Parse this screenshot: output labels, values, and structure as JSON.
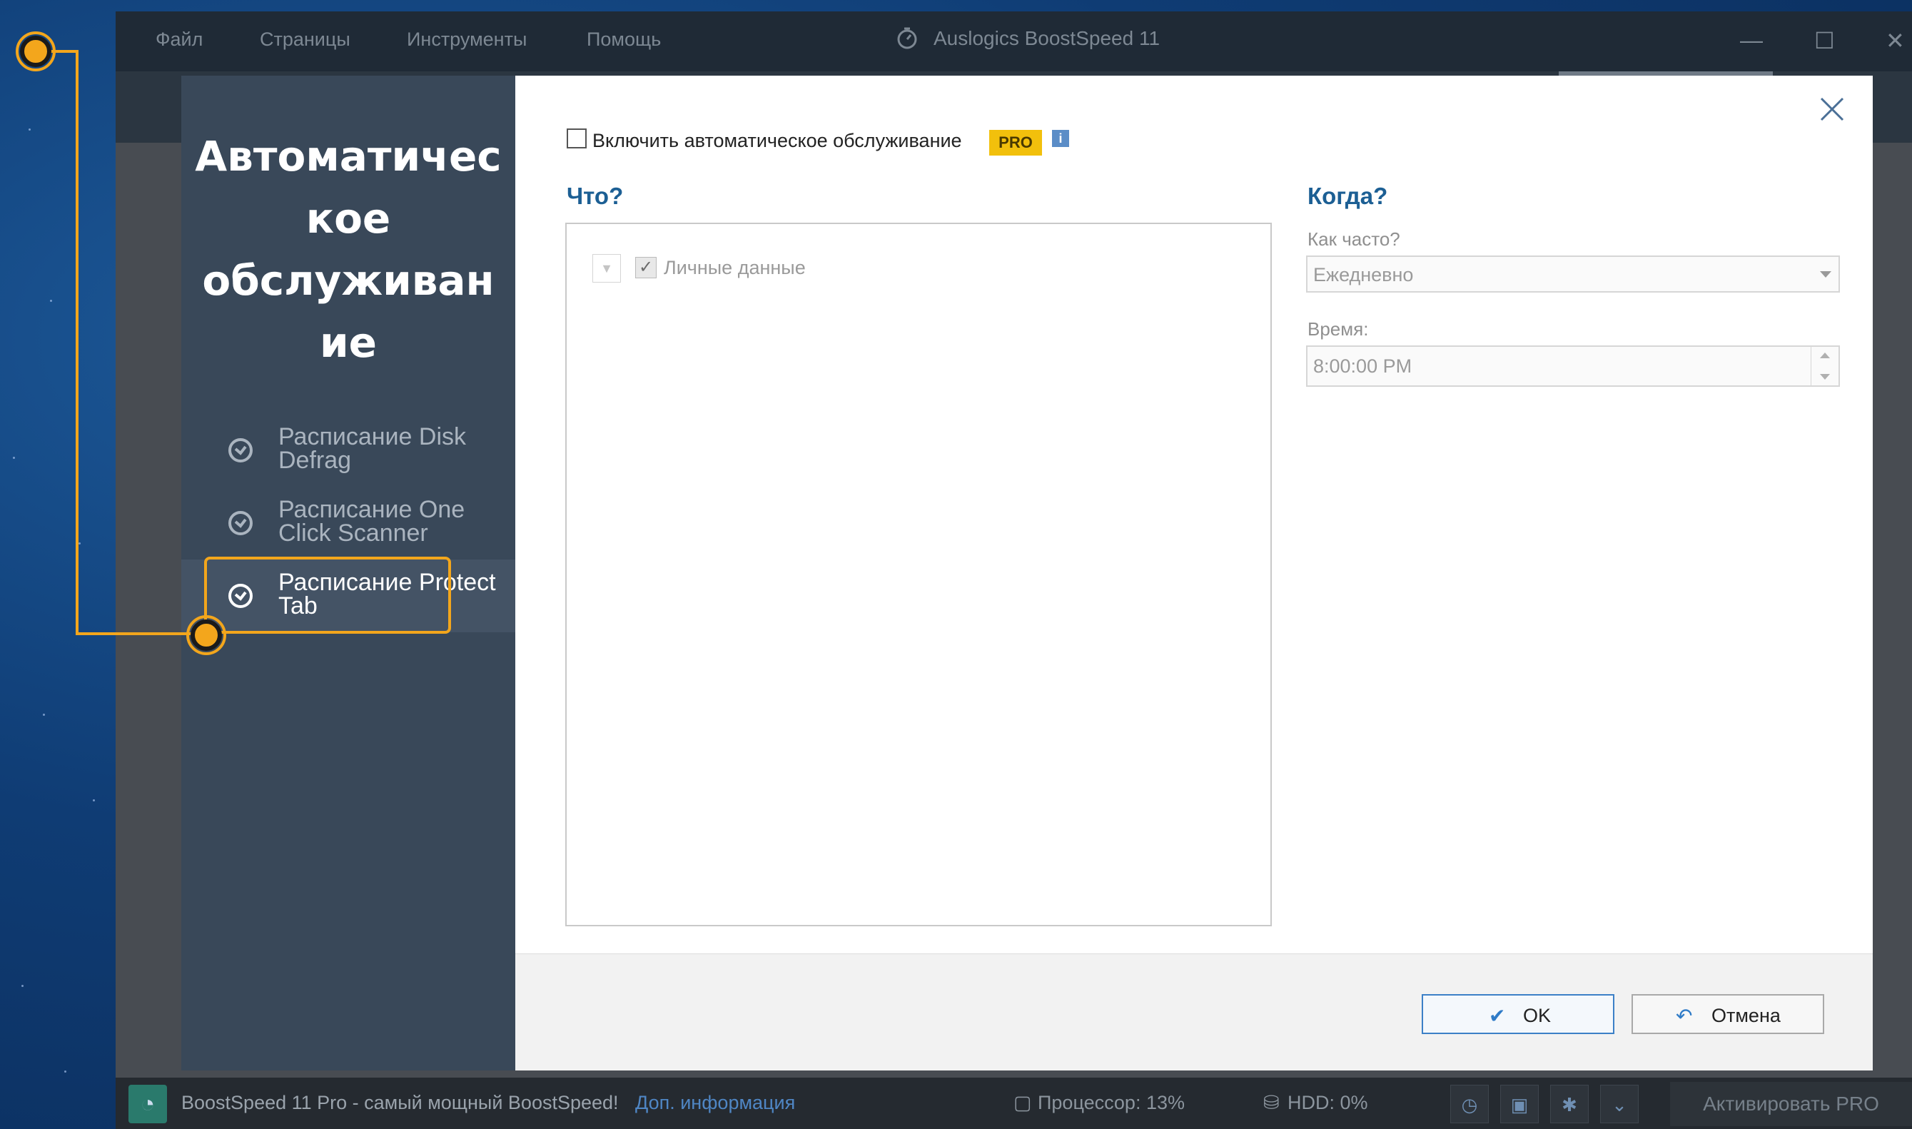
{
  "app": {
    "menu": [
      "Файл",
      "Страницы",
      "Инструменты",
      "Помощь"
    ],
    "title": "Auslogics BoostSpeed 11",
    "timer_icon": "stopwatch-icon"
  },
  "dialog": {
    "heading": "Автоматическое обслуживание",
    "nav": [
      {
        "label": "Расписание Disk Defrag",
        "icon": "clock-icon",
        "active": false
      },
      {
        "label": "Расписание One Click Scanner",
        "icon": "clock-icon",
        "active": false
      },
      {
        "label": "Расписание Protect Tab",
        "icon": "clock-icon",
        "active": true
      }
    ],
    "enable_label": "Включить автоматическое обслуживание",
    "pro_badge": "PRO",
    "info_glyph": "i",
    "what": {
      "heading": "Что?",
      "items": [
        {
          "label": "Личные данные",
          "checked": true
        }
      ]
    },
    "when": {
      "heading": "Когда?",
      "frequency_label": "Как часто?",
      "frequency_value": "Ежедневно",
      "time_label": "Время:",
      "time_value": "8:00:00 PM"
    },
    "buttons": {
      "ok": "OK",
      "cancel": "Отмена"
    }
  },
  "statusbar": {
    "text": "BoostSpeed 11 Pro - самый мощный BoostSpeed!",
    "link": "Доп. информация",
    "cpu": "Процессор: 13%",
    "hdd": "HDD: 0%",
    "activate": "Активировать PRO"
  },
  "colors": {
    "accent": "#1c5f94",
    "callout": "#f3a61c",
    "pro_badge": "#f2c00c",
    "sidebar": "#394859"
  }
}
